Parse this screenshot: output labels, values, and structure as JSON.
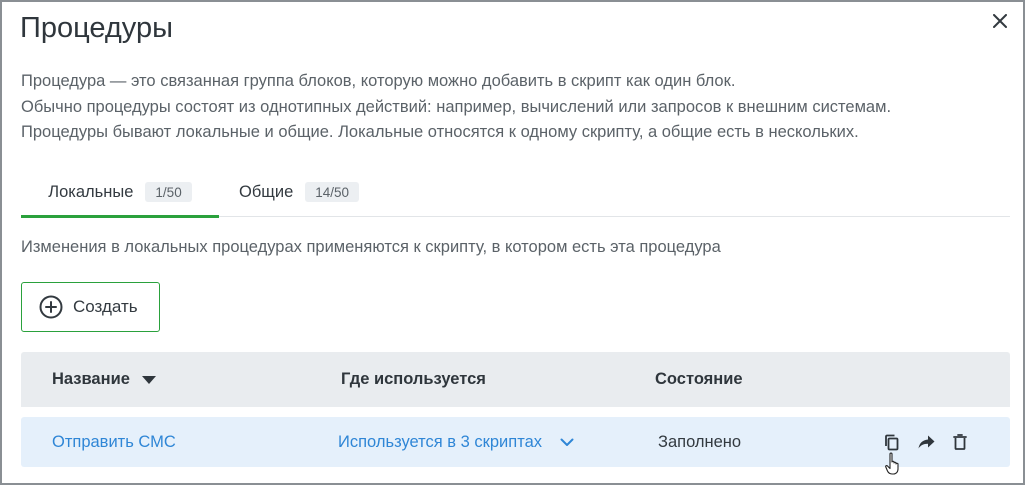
{
  "dialog": {
    "title": "Процедуры",
    "close_icon": "close-icon"
  },
  "description": {
    "line1": "Процедура — это связанная группа блоков, которую можно добавить в скрипт как один блок.",
    "line2": "Обычно процедуры состоят из однотипных действий: например, вычислений или запросов к внешним системам.",
    "line3": "Процедуры бывают локальные и общие. Локальные относятся к одному скрипту, а общие есть в нескольких."
  },
  "tabs": [
    {
      "label": "Локальные",
      "count": "1/50",
      "active": true
    },
    {
      "label": "Общие",
      "count": "14/50",
      "active": false
    }
  ],
  "note": "Изменения в локальных процедурах применяются к скрипту, в котором есть эта процедура",
  "create_button": {
    "label": "Создать",
    "icon": "plus-circle-icon"
  },
  "table": {
    "headers": {
      "name": "Название",
      "used": "Где используется",
      "state": "Состояние"
    },
    "sort_icon": "sort-desc-icon",
    "rows": [
      {
        "name": "Отправить СМС",
        "used": "Используется в 3 скриптах",
        "state": "Заполнено",
        "actions": [
          "copy-icon",
          "share-arrow-icon",
          "trash-icon"
        ]
      }
    ]
  },
  "colors": {
    "accent_green": "#2aa13c",
    "link_blue": "#2f86d6",
    "row_highlight": "#e5f0fb",
    "header_bg": "#e9ecef"
  }
}
